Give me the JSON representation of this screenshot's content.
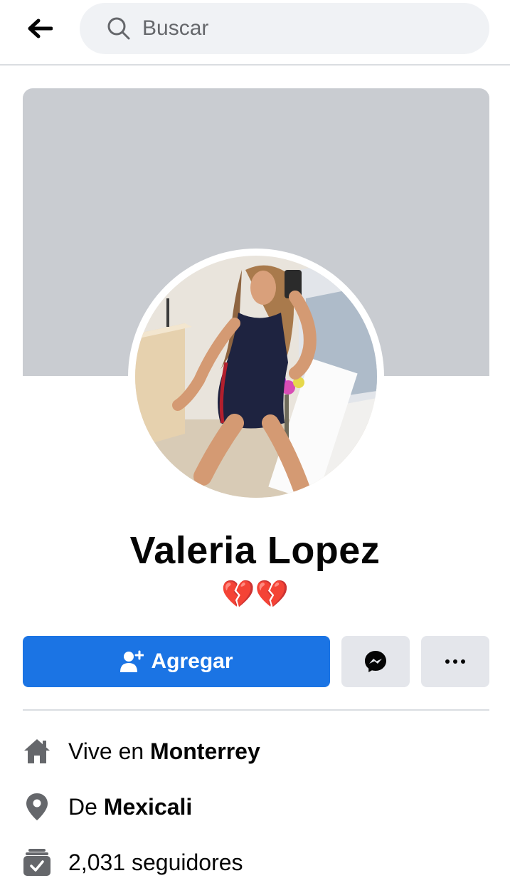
{
  "header": {
    "back_icon": "arrow-left-icon",
    "search": {
      "placeholder": "Buscar",
      "icon": "search-icon"
    }
  },
  "profile": {
    "name": "Valeria Lopez",
    "bio": "💔💔",
    "cover_color": "#c9ccd1"
  },
  "actions": {
    "add_label": "Agregar",
    "add_icon": "add-friend-icon",
    "messenger_icon": "messenger-icon",
    "more_icon": "more-dots-icon",
    "accent": "#1b74e4"
  },
  "intro": {
    "lives": {
      "icon": "home-icon",
      "prefix": "Vive en ",
      "value": "Monterrey"
    },
    "from": {
      "icon": "location-pin-icon",
      "prefix": "De ",
      "value": "Mexicali"
    },
    "followers": {
      "icon": "followers-icon",
      "text": "2,031 seguidores"
    }
  }
}
